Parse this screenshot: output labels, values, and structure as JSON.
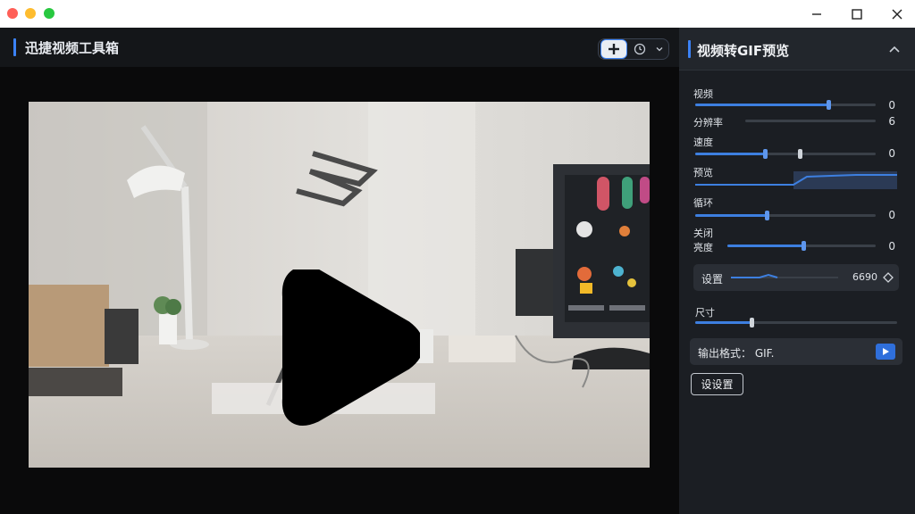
{
  "window": {
    "controls": [
      "close-dot",
      "minimize-dot",
      "zoom-dot"
    ]
  },
  "header": {
    "title": "迅捷视频工具箱"
  },
  "toolbar": {
    "icons": [
      "plus-icon",
      "clock-icon",
      "chevron-down-icon"
    ]
  },
  "video": {
    "overlay_icon": "play-icon"
  },
  "panel": {
    "title": "视频转GIF预览",
    "sliders": [
      {
        "label": "视频",
        "value": "0",
        "fill": 0.74
      },
      {
        "label": "分辨率",
        "value": "6",
        "fill": 0.0
      },
      {
        "label": "速度",
        "value": "0",
        "fill": 0.38
      },
      {
        "label": "预览",
        "value": "",
        "fill": 0.5
      },
      {
        "label": "循环",
        "value": "0",
        "fill": 0.39
      },
      {
        "label": "亮度",
        "value": "0",
        "fill": 0.52
      }
    ],
    "slider_label_extra": "关闭",
    "setting": {
      "label": "设置",
      "value": "6690"
    },
    "quality": {
      "label": "尺寸",
      "fill": 0.28
    },
    "output": {
      "label": "输出格式： GIF."
    },
    "settings_button": "设设置"
  },
  "colors": {
    "accent": "#3b82f6",
    "panel_bg": "#1b1e23",
    "main_bg": "#0d0e10"
  }
}
